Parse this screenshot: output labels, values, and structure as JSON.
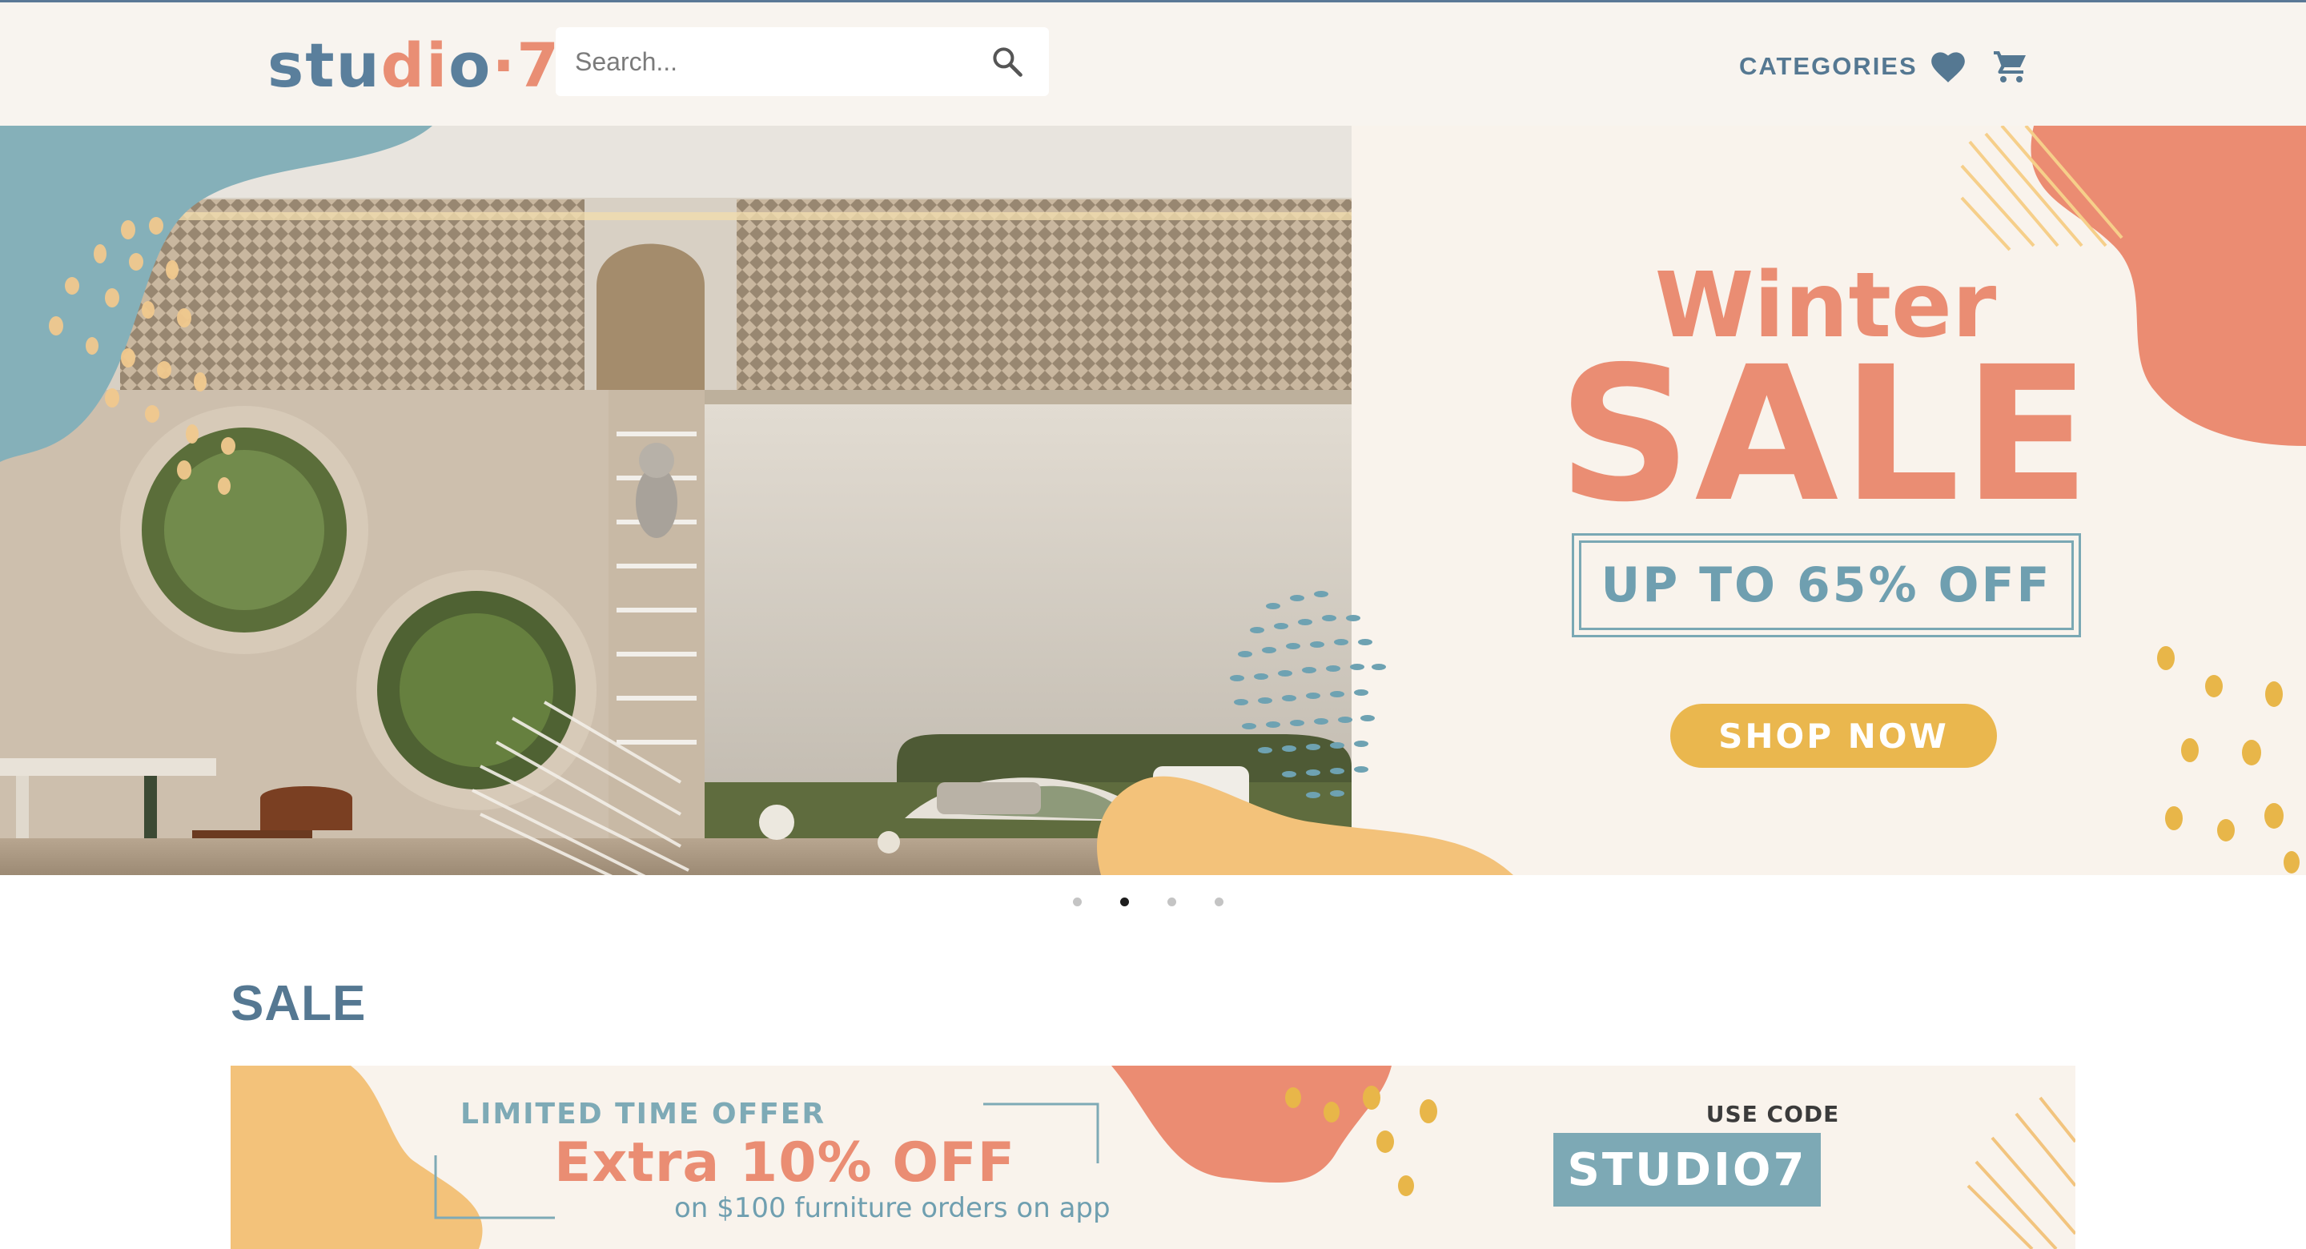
{
  "header": {
    "logo": {
      "part1": "stu",
      "part2": "di",
      "part3": "o",
      "part4": "·7:"
    },
    "search": {
      "placeholder": "Search...",
      "value": ""
    },
    "nav": {
      "categories_label": "CATEGORIES"
    },
    "icons": {
      "search": "search-icon",
      "wishlist": "heart-icon",
      "cart": "cart-icon"
    }
  },
  "hero": {
    "slide": {
      "title_line1": "Winter",
      "title_line2": "SALE",
      "discount": "UP TO 65% OFF",
      "cta_label": "SHOP NOW"
    },
    "carousel": {
      "total_slides": 4,
      "active_index": 1
    }
  },
  "sale_section": {
    "title": "SALE",
    "promo": {
      "kicker": "LIMITED TIME OFFER",
      "headline": "Extra 10% OFF",
      "subtext": "on $100 furniture orders on app",
      "code_label": "USE CODE",
      "code": "STUDIO7"
    }
  },
  "colors": {
    "brand_blue": "#557892",
    "coral": "#ea8d73",
    "mustard": "#eab74e",
    "teal": "#7da9b5",
    "cream": "#f9f3ec"
  }
}
